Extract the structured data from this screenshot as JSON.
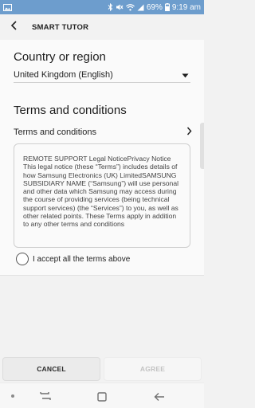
{
  "status_bar": {
    "battery_percent": "69%",
    "time": "9:19 am",
    "icons": [
      "image-icon",
      "bluetooth-icon",
      "mute-icon",
      "wifi-icon",
      "signal-icon",
      "battery-icon"
    ]
  },
  "app_bar": {
    "title": "SMART TUTOR",
    "back_icon": "back-arrow-icon"
  },
  "country": {
    "section_title": "Country or region",
    "selected_value": "United Kingdom (English)"
  },
  "terms": {
    "section_title": "Terms and conditions",
    "link_label": "Terms and conditions",
    "body_text": "REMOTE SUPPORT Legal NoticePrivacy Notice This legal notice (these “Terms”) includes details of how Samsung Electronics (UK) LimitedSAMSUNG SUBSIDIARY NAME (“Samsung”) will use personal and other data which Samsung may access during the course of providing services (being technical support services) (the “Services”) to you, as well as other related points. These Terms apply in addition to any other terms and conditions"
  },
  "accept": {
    "label": "I accept all the terms above",
    "checked": false
  },
  "actions": {
    "cancel_label": "CANCEL",
    "agree_label": "AGREE",
    "agree_enabled": false
  },
  "colors": {
    "status_bar": "#6d9dcd",
    "background": "#f2f2f2",
    "disabled_text": "#c2c2c2"
  }
}
